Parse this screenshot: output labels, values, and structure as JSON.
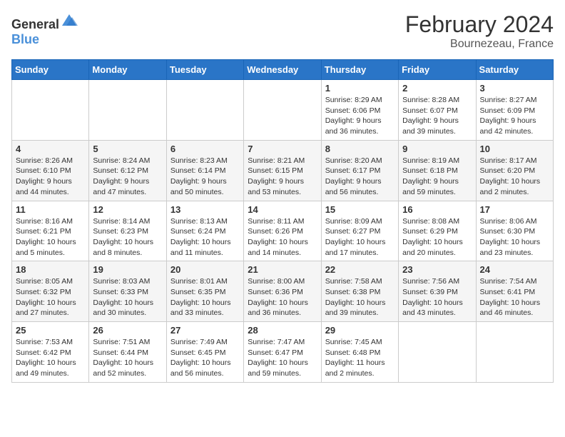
{
  "header": {
    "logo_general": "General",
    "logo_blue": "Blue",
    "month_year": "February 2024",
    "location": "Bournezeau, France"
  },
  "weekdays": [
    "Sunday",
    "Monday",
    "Tuesday",
    "Wednesday",
    "Thursday",
    "Friday",
    "Saturday"
  ],
  "weeks": [
    [
      {
        "day": "",
        "info": ""
      },
      {
        "day": "",
        "info": ""
      },
      {
        "day": "",
        "info": ""
      },
      {
        "day": "",
        "info": ""
      },
      {
        "day": "1",
        "info": "Sunrise: 8:29 AM\nSunset: 6:06 PM\nDaylight: 9 hours and 36 minutes."
      },
      {
        "day": "2",
        "info": "Sunrise: 8:28 AM\nSunset: 6:07 PM\nDaylight: 9 hours and 39 minutes."
      },
      {
        "day": "3",
        "info": "Sunrise: 8:27 AM\nSunset: 6:09 PM\nDaylight: 9 hours and 42 minutes."
      }
    ],
    [
      {
        "day": "4",
        "info": "Sunrise: 8:26 AM\nSunset: 6:10 PM\nDaylight: 9 hours and 44 minutes."
      },
      {
        "day": "5",
        "info": "Sunrise: 8:24 AM\nSunset: 6:12 PM\nDaylight: 9 hours and 47 minutes."
      },
      {
        "day": "6",
        "info": "Sunrise: 8:23 AM\nSunset: 6:14 PM\nDaylight: 9 hours and 50 minutes."
      },
      {
        "day": "7",
        "info": "Sunrise: 8:21 AM\nSunset: 6:15 PM\nDaylight: 9 hours and 53 minutes."
      },
      {
        "day": "8",
        "info": "Sunrise: 8:20 AM\nSunset: 6:17 PM\nDaylight: 9 hours and 56 minutes."
      },
      {
        "day": "9",
        "info": "Sunrise: 8:19 AM\nSunset: 6:18 PM\nDaylight: 9 hours and 59 minutes."
      },
      {
        "day": "10",
        "info": "Sunrise: 8:17 AM\nSunset: 6:20 PM\nDaylight: 10 hours and 2 minutes."
      }
    ],
    [
      {
        "day": "11",
        "info": "Sunrise: 8:16 AM\nSunset: 6:21 PM\nDaylight: 10 hours and 5 minutes."
      },
      {
        "day": "12",
        "info": "Sunrise: 8:14 AM\nSunset: 6:23 PM\nDaylight: 10 hours and 8 minutes."
      },
      {
        "day": "13",
        "info": "Sunrise: 8:13 AM\nSunset: 6:24 PM\nDaylight: 10 hours and 11 minutes."
      },
      {
        "day": "14",
        "info": "Sunrise: 8:11 AM\nSunset: 6:26 PM\nDaylight: 10 hours and 14 minutes."
      },
      {
        "day": "15",
        "info": "Sunrise: 8:09 AM\nSunset: 6:27 PM\nDaylight: 10 hours and 17 minutes."
      },
      {
        "day": "16",
        "info": "Sunrise: 8:08 AM\nSunset: 6:29 PM\nDaylight: 10 hours and 20 minutes."
      },
      {
        "day": "17",
        "info": "Sunrise: 8:06 AM\nSunset: 6:30 PM\nDaylight: 10 hours and 23 minutes."
      }
    ],
    [
      {
        "day": "18",
        "info": "Sunrise: 8:05 AM\nSunset: 6:32 PM\nDaylight: 10 hours and 27 minutes."
      },
      {
        "day": "19",
        "info": "Sunrise: 8:03 AM\nSunset: 6:33 PM\nDaylight: 10 hours and 30 minutes."
      },
      {
        "day": "20",
        "info": "Sunrise: 8:01 AM\nSunset: 6:35 PM\nDaylight: 10 hours and 33 minutes."
      },
      {
        "day": "21",
        "info": "Sunrise: 8:00 AM\nSunset: 6:36 PM\nDaylight: 10 hours and 36 minutes."
      },
      {
        "day": "22",
        "info": "Sunrise: 7:58 AM\nSunset: 6:38 PM\nDaylight: 10 hours and 39 minutes."
      },
      {
        "day": "23",
        "info": "Sunrise: 7:56 AM\nSunset: 6:39 PM\nDaylight: 10 hours and 43 minutes."
      },
      {
        "day": "24",
        "info": "Sunrise: 7:54 AM\nSunset: 6:41 PM\nDaylight: 10 hours and 46 minutes."
      }
    ],
    [
      {
        "day": "25",
        "info": "Sunrise: 7:53 AM\nSunset: 6:42 PM\nDaylight: 10 hours and 49 minutes."
      },
      {
        "day": "26",
        "info": "Sunrise: 7:51 AM\nSunset: 6:44 PM\nDaylight: 10 hours and 52 minutes."
      },
      {
        "day": "27",
        "info": "Sunrise: 7:49 AM\nSunset: 6:45 PM\nDaylight: 10 hours and 56 minutes."
      },
      {
        "day": "28",
        "info": "Sunrise: 7:47 AM\nSunset: 6:47 PM\nDaylight: 10 hours and 59 minutes."
      },
      {
        "day": "29",
        "info": "Sunrise: 7:45 AM\nSunset: 6:48 PM\nDaylight: 11 hours and 2 minutes."
      },
      {
        "day": "",
        "info": ""
      },
      {
        "day": "",
        "info": ""
      }
    ]
  ]
}
